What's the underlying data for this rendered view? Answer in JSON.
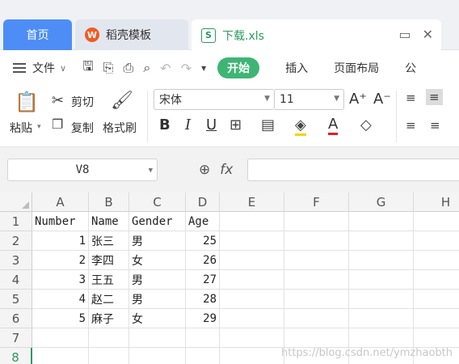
{
  "tabs": {
    "home": "首页",
    "template": "稻壳模板",
    "template_logo": "W",
    "file": "下载.xls",
    "file_icon": "S"
  },
  "menu": {
    "file_menu": "文件",
    "active_tab": "开始",
    "tabs": [
      "插入",
      "页面布局",
      "公"
    ]
  },
  "ribbon": {
    "paste": "粘贴",
    "cut": "剪切",
    "copy": "复制",
    "format_painter": "格式刷",
    "font_name": "宋体",
    "font_size": "11",
    "bold": "B",
    "italic": "I",
    "underline": "U"
  },
  "formula_bar": {
    "cell_ref": "V8",
    "fx": "fx",
    "formula": ""
  },
  "sheet": {
    "columns": [
      "A",
      "B",
      "C",
      "D",
      "E",
      "F",
      "G",
      "H"
    ],
    "row_numbers": [
      "1",
      "2",
      "3",
      "4",
      "5",
      "6",
      "7",
      "8"
    ],
    "active_row": "8",
    "headers": [
      "Number",
      "Name",
      "Gender",
      "Age"
    ],
    "rows": [
      [
        "1",
        "张三",
        "男",
        "25"
      ],
      [
        "2",
        "李四",
        "女",
        "26"
      ],
      [
        "3",
        "王五",
        "男",
        "27"
      ],
      [
        "4",
        "赵二",
        "男",
        "28"
      ],
      [
        "5",
        "麻子",
        "女",
        "29"
      ]
    ]
  },
  "watermark": "https://blog.csdn.net/ymzhaobth",
  "colors": {
    "tab_active": "#4e8df5",
    "accent_green": "#3eb575",
    "file_green": "#2a9a5f"
  }
}
